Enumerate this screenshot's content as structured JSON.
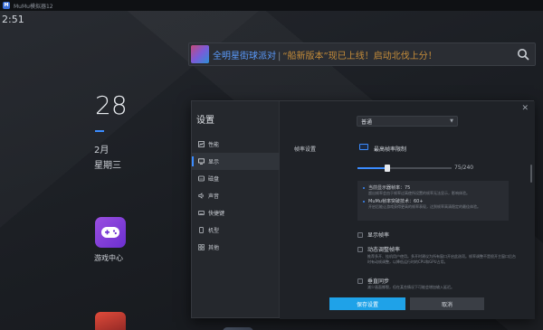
{
  "window": {
    "title": "MuMu模拟器12",
    "logo": "mumu-logo-icon"
  },
  "android": {
    "status_time": "2:51",
    "search_banner": {
      "highlight": "全明星街球派对",
      "separator": "|",
      "text": "“船新版本”现已上线！启动北伐上分！"
    },
    "date": {
      "day": "28",
      "month": "2月",
      "weekday": "星期三"
    },
    "apps": [
      {
        "label": "游戏中心",
        "icon": "gamepad-icon"
      }
    ]
  },
  "settings": {
    "title": "设置",
    "close_label": "✕",
    "nav": [
      {
        "label": "性能",
        "icon": "performance-icon"
      },
      {
        "label": "显示",
        "icon": "display-icon",
        "active": true
      },
      {
        "label": "磁盘",
        "icon": "disk-icon"
      },
      {
        "label": "声音",
        "icon": "sound-icon"
      },
      {
        "label": "快捷键",
        "icon": "keyboard-icon"
      },
      {
        "label": "机型",
        "icon": "phone-icon"
      },
      {
        "label": "其他",
        "icon": "grid-icon"
      }
    ],
    "display": {
      "quality_select": "普通",
      "fps_label": "帧率设置",
      "fps_unlimited_label": "最高帧率限制",
      "fps_slider": {
        "value": 75,
        "max": 240,
        "text": "75/240"
      },
      "info": {
        "line1": "当前显示器帧率：75",
        "line1_sub": "超出帧率会由于帧率过高使所设置的帧率无法显示，影响体验。",
        "line2": "MuMu帧率突破技术：60+",
        "line2_sub": "开启后能让游戏获得更高的帧率表现，达到帧率高清稳定的最佳体验。"
      },
      "options": [
        {
          "label": "显示帧率",
          "checked": false
        },
        {
          "label": "动态调整帧率",
          "checked": false,
          "desc": "推荐多开、挂机用户使用。多开时建议为所有窗口开启此选项。帧率调整不是很开主窗口后台时有动帧调整，以降低运行时的CPU和GPU占用。"
        },
        {
          "label": "垂直同步",
          "checked": false,
          "desc": "减少画面撕裂，但在某些情况下可能会增加输入延迟。"
        }
      ]
    },
    "buttons": {
      "save": "保存设置",
      "cancel": "取消"
    }
  },
  "colors": {
    "accent": "#3b8cff",
    "save_button": "#1fa2e8",
    "dialog_bg": "#25282d"
  }
}
